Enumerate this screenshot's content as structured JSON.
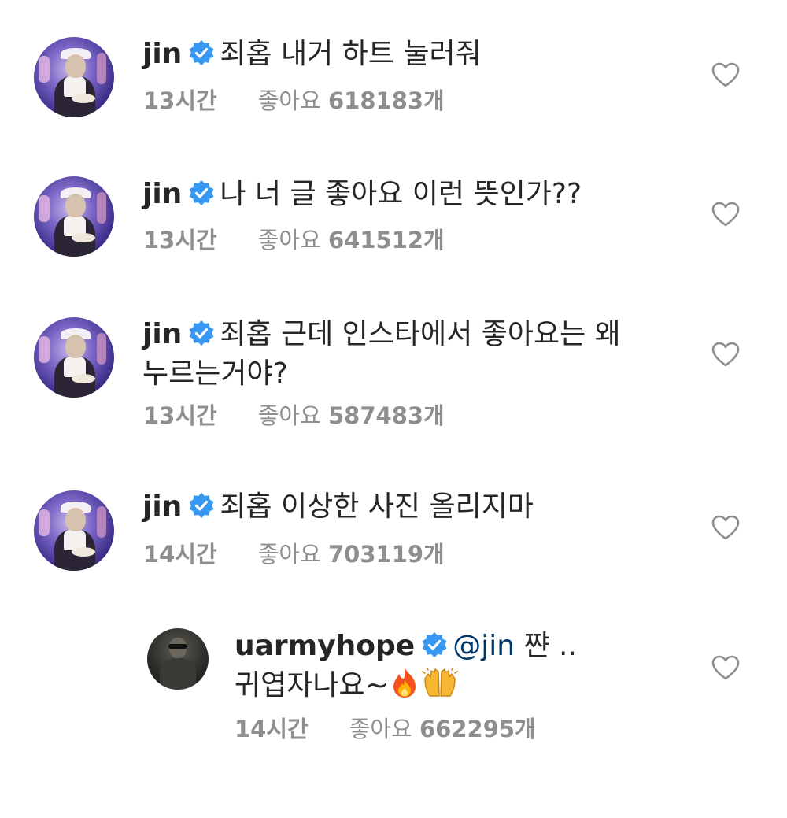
{
  "comments": [
    {
      "username": "jin",
      "text": "죄홉 내거 하트 눌러줘",
      "text2": "",
      "time": "13시간",
      "likes_label": "좋아요",
      "likes_count": "618183개"
    },
    {
      "username": "jin",
      "text": "나 너 글 좋아요 이런 뜻인가??",
      "text2": "",
      "time": "13시간",
      "likes_label": "좋아요",
      "likes_count": "641512개"
    },
    {
      "username": "jin",
      "text": "죄홉 근데 인스타에서 좋아요는 왜",
      "text2": "누르는거야?",
      "time": "13시간",
      "likes_label": "좋아요",
      "likes_count": "587483개"
    },
    {
      "username": "jin",
      "text": "죄홉 이상한 사진 올리지마",
      "text2": "",
      "time": "14시간",
      "likes_label": "좋아요",
      "likes_count": "703119개"
    }
  ],
  "reply": {
    "username": "uarmyhope",
    "mention": "@jin",
    "text": "쨘 ..",
    "text2": "귀엽자나요~",
    "emojis": [
      "fire-emoji",
      "raising-hands-emoji"
    ],
    "time": "14시간",
    "likes_label": "좋아요",
    "likes_count": "662295개"
  },
  "colors": {
    "text": "#262626",
    "meta": "#8e8e8e",
    "verified": "#3897f0",
    "mention": "#00376b"
  }
}
